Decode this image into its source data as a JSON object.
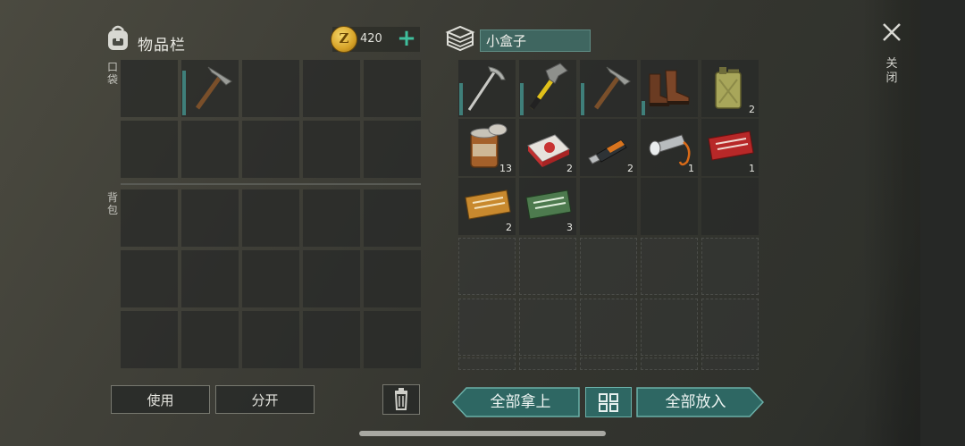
{
  "inventory": {
    "title": "物品栏",
    "coins": "420",
    "coin_symbol": "Z",
    "pockets_label": "口袋",
    "backpack_label": "背包"
  },
  "container": {
    "name": "小盒子"
  },
  "container_items": [
    {
      "icon": "pickaxe-alt-icon",
      "count": ""
    },
    {
      "icon": "hammer-icon",
      "count": ""
    },
    {
      "icon": "pickaxe-icon",
      "count": ""
    },
    {
      "icon": "boots-icon",
      "count": ""
    },
    {
      "icon": "jerrycan-icon",
      "count": "2"
    },
    {
      "icon": "tin-can-icon",
      "count": "13"
    },
    {
      "icon": "cigarette-pack-icon",
      "count": "2"
    },
    {
      "icon": "usb-drive-icon",
      "count": "2"
    },
    {
      "icon": "flashlight-icon",
      "count": "1"
    },
    {
      "icon": "red-coupon-icon",
      "count": "1"
    },
    {
      "icon": "orange-coupon-icon",
      "count": "2"
    },
    {
      "icon": "green-coupon-icon",
      "count": "3"
    }
  ],
  "buttons": {
    "use": "使用",
    "split": "分开",
    "take_all": "全部拿上",
    "put_all": "全部放入",
    "close": "关闭"
  },
  "colors": {
    "accent_teal": "#2e6763",
    "coin_gold": "#d6a227",
    "plus_green": "#3fbf9d"
  }
}
